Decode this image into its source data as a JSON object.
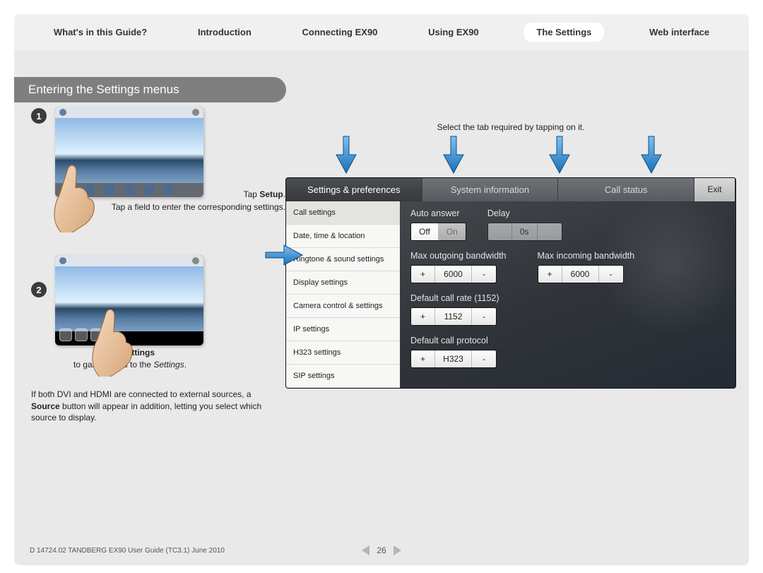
{
  "nav": {
    "items": [
      "What's in this Guide?",
      "Introduction",
      "Connecting EX90",
      "Using EX90",
      "The Settings",
      "Web interface"
    ],
    "active_index": 4
  },
  "heading": "Entering the Settings menus",
  "steps": {
    "one": {
      "num": "1",
      "caption_pre": "Tap ",
      "caption_bold": "Setup",
      "caption_post": "."
    },
    "two": {
      "num": "2",
      "caption_pre": "Tap ",
      "caption_bold": "Settings",
      "caption_post2_pre": "to gain access to the ",
      "caption_post2_italic": "Settings",
      "caption_post2_post": "."
    }
  },
  "right_hint": "Select the tab required by tapping on it.",
  "side_hint": "Tap a field to enter the corresponding settings.",
  "panel": {
    "tabs": [
      "Settings & preferences",
      "System information",
      "Call status",
      "Exit"
    ],
    "side_items": [
      "Call settings",
      "Date, time & location",
      "Ringtone & sound settings",
      "Display settings",
      "Camera control & settings",
      "IP settings",
      "H323 settings",
      "SIP settings"
    ],
    "auto_answer": {
      "label": "Auto answer",
      "off": "Off",
      "on": "On"
    },
    "delay": {
      "label": "Delay",
      "value": "0s"
    },
    "out_bw": {
      "label": "Max outgoing bandwidth",
      "value": "6000"
    },
    "in_bw": {
      "label": "Max incoming bandwidth",
      "value": "6000"
    },
    "call_rate": {
      "label": "Default call rate (1152)",
      "value": "1152"
    },
    "call_proto": {
      "label": "Default call protocol",
      "value": "H323"
    },
    "plus": "+",
    "minus": "-"
  },
  "note": {
    "pre": "If both DVI and HDMI are connected to external sources, a ",
    "bold": "Source",
    "post": " button will appear in addition, letting you select which source to display."
  },
  "footer": {
    "doc": "D 14724.02 TANDBERG EX90 User Guide (TC3.1) June 2010",
    "page": "26"
  }
}
